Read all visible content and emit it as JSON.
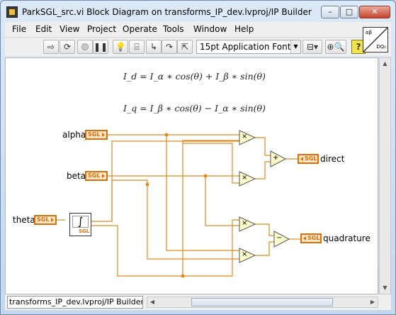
{
  "window": {
    "title": "ParkSGL_src.vi Block Diagram on transforms_IP_dev.lvproj/IP Builder",
    "minimize": "–",
    "maximize": "□",
    "close": "✕"
  },
  "menu": [
    "File",
    "Edit",
    "View",
    "Project",
    "Operate",
    "Tools",
    "Window",
    "Help"
  ],
  "toolbar": {
    "font": "15pt Application Font",
    "buttons": [
      "run-arrow-icon",
      "run-continuous-icon",
      "abort-icon",
      "pause-icon",
      "highlight-execution-icon",
      "retain-wire-values-icon",
      "step-into-icon",
      "step-over-icon",
      "step-out-icon",
      "align-icon",
      "search-icon",
      "help-icon"
    ]
  },
  "vi_icon": {
    "top": "αβ",
    "bottom": "DQ₀"
  },
  "formulas": {
    "id": "I_d = I_α ∗ cos(θ) + I_β ∗ sin(θ)",
    "iq": "I_q = I_β ∗ cos(θ) − I_α ∗ sin(θ)"
  },
  "terminals": {
    "alpha": {
      "label": "alpha",
      "type": "SGL"
    },
    "beta": {
      "label": "beta",
      "type": "SGL"
    },
    "theta": {
      "label": "theta",
      "type": "SGL"
    },
    "direct": {
      "label": "direct",
      "type": "SGL"
    },
    "quadrature": {
      "label": "quadrature",
      "type": "SGL"
    }
  },
  "sincos_type": "SGL",
  "operators": {
    "multiply": "×",
    "add": "+",
    "subtract": "−"
  },
  "status": {
    "project_path": "transforms_IP_dev.lvproj/IP Builder"
  },
  "colors": {
    "wire": "#e08a1e",
    "terminal": "#d86f0a"
  }
}
